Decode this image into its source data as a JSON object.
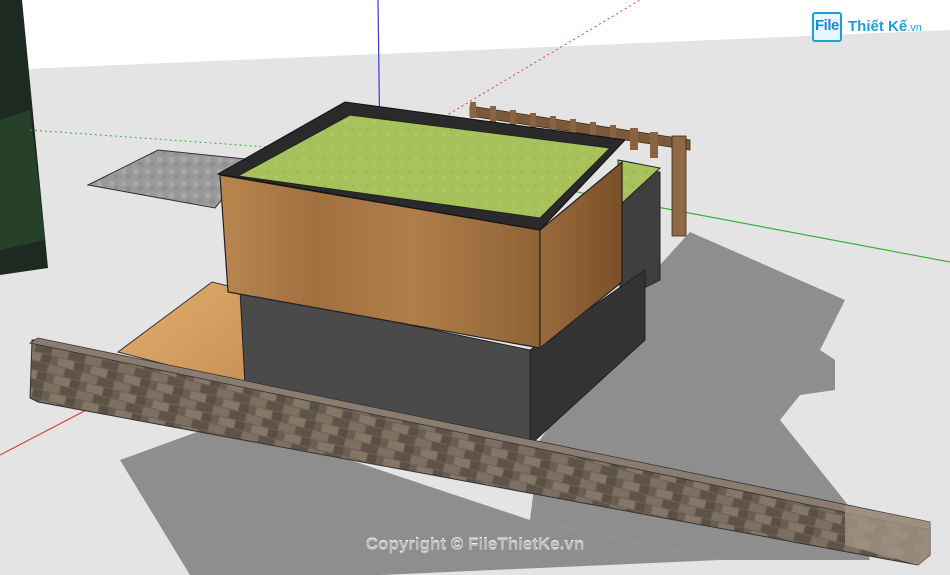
{
  "app": {
    "watermark_logo": {
      "file_text": "File",
      "rest_text": "Thiết Kế",
      "suffix_text": ".vn"
    },
    "copyright": "Copyright © FileThietKe.vn"
  },
  "colors": {
    "ground": "#e6e6e6",
    "sky": "#ffffff",
    "grass": "#a4bf5a",
    "wood": "#a97a4a",
    "dark_wall": "#4a4a4a",
    "stone_wall": "#6b5e52",
    "shadow": "#8c8c8c",
    "axis_red": "#d94040",
    "axis_green": "#3ab03a",
    "axis_blue": "#3a3ad9"
  }
}
